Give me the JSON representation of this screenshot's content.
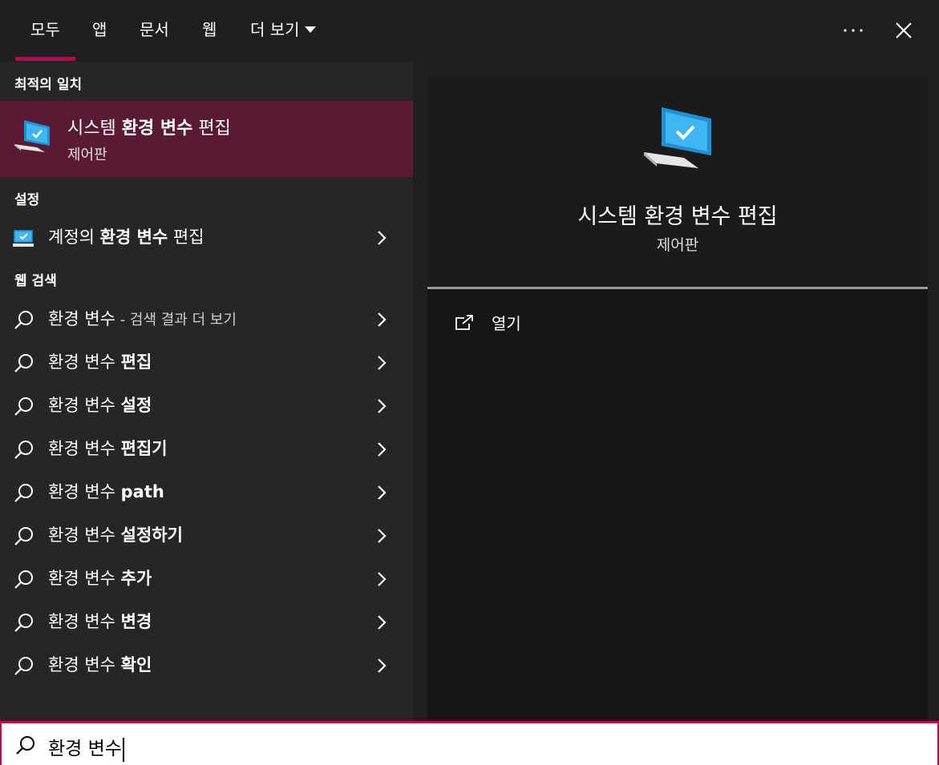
{
  "tabs": [
    {
      "label": "모두"
    },
    {
      "label": "앱"
    },
    {
      "label": "문서"
    },
    {
      "label": "웹"
    },
    {
      "label": "더 보기"
    }
  ],
  "accent_color": "#c30052",
  "best_match": {
    "header": "최적의 일치",
    "title_plain": "시스템 ",
    "title_bold": "환경 변수",
    "title_rest": " 편집",
    "subtitle": "제어판",
    "icon": "monitor-icon"
  },
  "settings": {
    "header": "설정",
    "item": {
      "plain": "계정의 ",
      "bold": "환경 변수",
      "rest": " 편집",
      "icon": "monitor-icon"
    }
  },
  "web": {
    "header": "웹 검색",
    "items": [
      {
        "plain": "환경 변수",
        "bold": "",
        "dim": " - 검색 결과 더 보기"
      },
      {
        "plain": "환경 변수 ",
        "bold": "편집",
        "dim": ""
      },
      {
        "plain": "환경 변수 ",
        "bold": "설정",
        "dim": ""
      },
      {
        "plain": "환경 변수 ",
        "bold": "편집기",
        "dim": ""
      },
      {
        "plain": "환경 변수 ",
        "bold": "path",
        "dim": ""
      },
      {
        "plain": "환경 변수 ",
        "bold": "설정하기",
        "dim": ""
      },
      {
        "plain": "환경 변수 ",
        "bold": "추가",
        "dim": ""
      },
      {
        "plain": "환경 변수 ",
        "bold": "변경",
        "dim": ""
      },
      {
        "plain": "환경 변수 ",
        "bold": "확인",
        "dim": ""
      }
    ]
  },
  "preview": {
    "title": "시스템 환경 변수 편집",
    "subtitle": "제어판",
    "open_label": "열기"
  },
  "search": {
    "value": "환경 변수"
  }
}
